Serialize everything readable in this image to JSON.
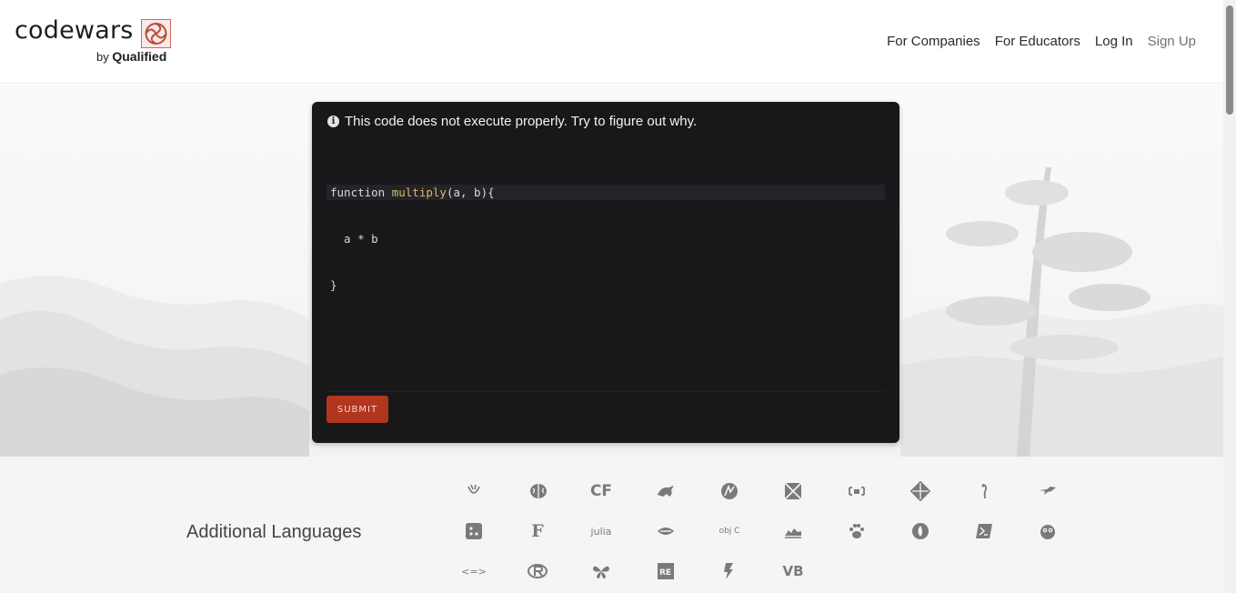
{
  "header": {
    "logo_word": "codewars",
    "logo_sub_prefix": "by",
    "logo_sub_brand": "Qualified",
    "nav": [
      "For Companies",
      "For Educators",
      "Log In",
      "Sign Up"
    ]
  },
  "panel": {
    "notice": "This code does not execute properly. Try to figure out why.",
    "code": {
      "line1_kw": "function ",
      "line1_fn": "multiply",
      "line1_rest": "(a, b){",
      "line2": "  a * b",
      "line3": "}"
    },
    "submit_label": "SUBMIT"
  },
  "languages": {
    "title": "Additional Languages",
    "row1_texts": {
      "cf": "CF"
    },
    "row2_texts": {
      "f": "F",
      "julia": "julia",
      "objc": "obj C"
    },
    "row3_texts": {
      "re": "RE",
      "vb": "VB",
      "arrow": "<=>"
    }
  },
  "colors": {
    "panel_bg": "#18181b",
    "submit_bg": "#b1361e",
    "accent_fn": "#d9b86e"
  }
}
